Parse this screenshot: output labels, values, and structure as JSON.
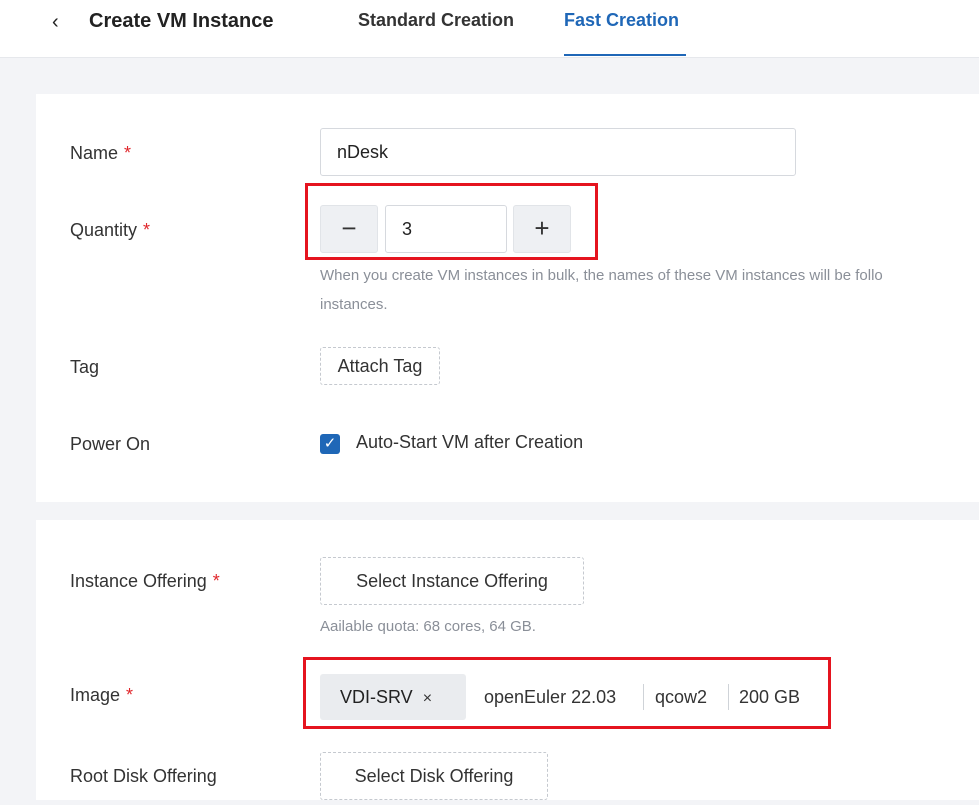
{
  "header": {
    "back_icon": "chevron-left-icon",
    "title": "Create VM Instance",
    "tabs": [
      {
        "label": "Standard Creation",
        "active": false
      },
      {
        "label": "Fast Creation",
        "active": true
      }
    ],
    "accent_color": "#1f67b7"
  },
  "basic": {
    "name": {
      "label": "Name",
      "required_mark": "*",
      "value": "nDesk"
    },
    "quantity": {
      "label": "Quantity",
      "required_mark": "*",
      "minus": "−",
      "plus": "+",
      "value": "3",
      "hint_line1": "When you create VM instances in bulk, the names of these VM instances will be follo",
      "hint_line2": "instances."
    },
    "tag": {
      "label": "Tag",
      "button": "Attach Tag"
    },
    "power_on": {
      "label": "Power On",
      "checkbox_label": "Auto-Start VM after Creation",
      "checked": true,
      "check_glyph": "✓"
    }
  },
  "resources": {
    "instance_offering": {
      "label": "Instance Offering",
      "required_mark": "*",
      "button": "Select Instance Offering",
      "hint": "Aailable quota: 68 cores, 64 GB."
    },
    "image": {
      "label": "Image",
      "required_mark": "*",
      "chip": "VDI-SRV",
      "chip_close": "×",
      "os": "openEuler 22.03",
      "format": "qcow2",
      "size": "200 GB"
    },
    "root_disk": {
      "label": "Root Disk Offering",
      "button": "Select Disk Offering"
    }
  },
  "annotations": {
    "highlight_color": "#e5141f"
  }
}
